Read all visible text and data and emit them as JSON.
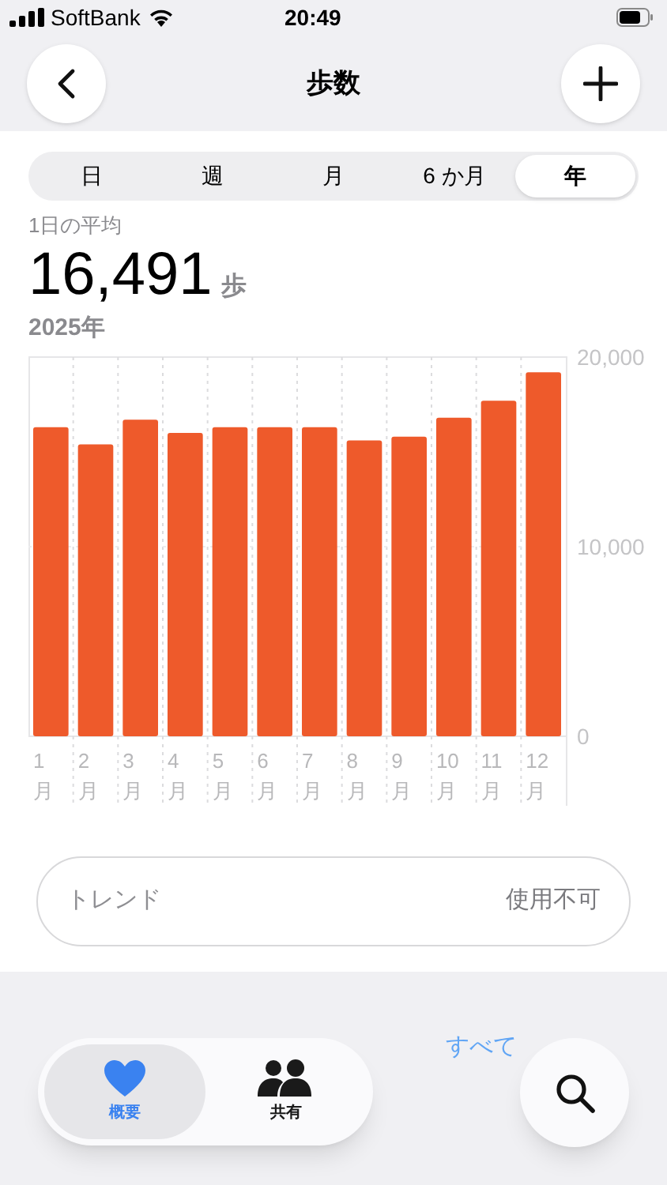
{
  "status_bar": {
    "carrier": "SoftBank",
    "time": "20:49"
  },
  "header": {
    "title": "歩数"
  },
  "periods": [
    {
      "label": "日",
      "selected": false
    },
    {
      "label": "週",
      "selected": false
    },
    {
      "label": "月",
      "selected": false
    },
    {
      "label": "6 か月",
      "selected": false
    },
    {
      "label": "年",
      "selected": true
    }
  ],
  "summary": {
    "caption": "1日の平均",
    "value": "16,491",
    "unit": "歩",
    "range": "2025年"
  },
  "chart_data": {
    "type": "bar",
    "categories": [
      "1月",
      "2月",
      "3月",
      "4月",
      "5月",
      "6月",
      "7月",
      "8月",
      "9月",
      "10月",
      "11月",
      "12月"
    ],
    "series": [
      {
        "color": "#ee5a2b",
        "values": [
          16300,
          15400,
          16700,
          16000,
          16300,
          16300,
          16300,
          15600,
          15800,
          16800,
          17700,
          19200
        ]
      }
    ],
    "ylim": [
      0,
      20000
    ],
    "yticks": [
      {
        "value": 0,
        "label": "0"
      },
      {
        "value": 10000,
        "label": "10,000"
      },
      {
        "value": 20000,
        "label": "20,000"
      }
    ]
  },
  "trend": {
    "label": "トレンド",
    "value": "使用不可"
  },
  "section": {
    "link": "すべて"
  },
  "tab_bar": [
    {
      "label": "概要",
      "kind": "heart",
      "selected": true
    },
    {
      "label": "共有",
      "kind": "people",
      "selected": false
    }
  ]
}
